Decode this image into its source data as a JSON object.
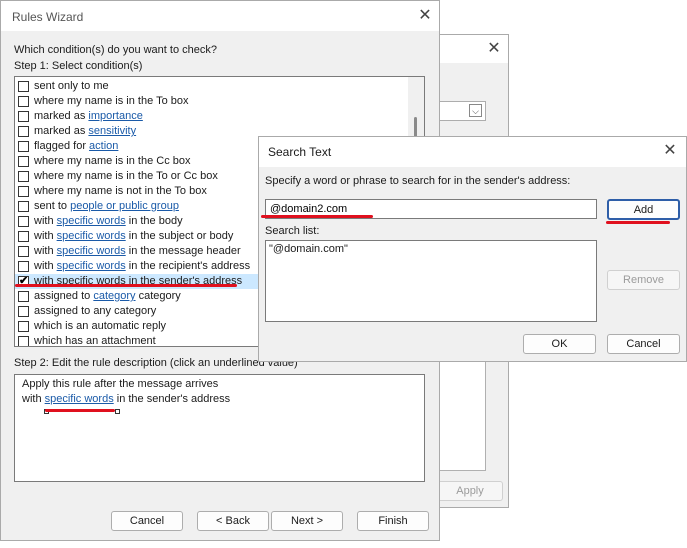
{
  "background_dialog": {
    "apply_label": "Apply"
  },
  "rules_wizard": {
    "title": "Rules Wizard",
    "question": "Which condition(s) do you want to check?",
    "step1": "Step 1: Select condition(s)",
    "conditions": [
      {
        "checked": false,
        "pre": "sent only to me",
        "link": "",
        "post": ""
      },
      {
        "checked": false,
        "pre": "where my name is in the To box",
        "link": "",
        "post": ""
      },
      {
        "checked": false,
        "pre": "marked as ",
        "link": "importance",
        "post": ""
      },
      {
        "checked": false,
        "pre": "marked as ",
        "link": "sensitivity",
        "post": ""
      },
      {
        "checked": false,
        "pre": "flagged for ",
        "link": "action",
        "post": ""
      },
      {
        "checked": false,
        "pre": "where my name is in the Cc box",
        "link": "",
        "post": ""
      },
      {
        "checked": false,
        "pre": "where my name is in the To or Cc box",
        "link": "",
        "post": ""
      },
      {
        "checked": false,
        "pre": "where my name is not in the To box",
        "link": "",
        "post": ""
      },
      {
        "checked": false,
        "pre": "sent to ",
        "link": "people or public group",
        "post": ""
      },
      {
        "checked": false,
        "pre": "with ",
        "link": "specific words",
        "post": " in the body"
      },
      {
        "checked": false,
        "pre": "with ",
        "link": "specific words",
        "post": " in the subject or body"
      },
      {
        "checked": false,
        "pre": "with ",
        "link": "specific words",
        "post": " in the message header"
      },
      {
        "checked": false,
        "pre": "with ",
        "link": "specific words",
        "post": " in the recipient's address"
      },
      {
        "checked": true,
        "pre": "with specific words in the sender's address",
        "link": "",
        "post": ""
      },
      {
        "checked": false,
        "pre": "assigned to ",
        "link": "category",
        "post": " category"
      },
      {
        "checked": false,
        "pre": "assigned to any category",
        "link": "",
        "post": ""
      },
      {
        "checked": false,
        "pre": "which is an automatic reply",
        "link": "",
        "post": ""
      },
      {
        "checked": false,
        "pre": "which has an attachment",
        "link": "",
        "post": ""
      }
    ],
    "step2": "Step 2: Edit the rule description (click an underlined value)",
    "desc_line1": "Apply this rule after the message arrives",
    "desc_line2_pre": "with ",
    "desc_line2_link": "specific words",
    "desc_line2_post": " in the sender's address",
    "buttons": {
      "cancel": "Cancel",
      "back": "< Back",
      "next": "Next >",
      "finish": "Finish"
    }
  },
  "search_text": {
    "title": "Search Text",
    "prompt": "Specify a word or phrase to search for in the sender's address:",
    "input_value": "@domain2.com",
    "add_label": "Add",
    "search_list_label": "Search list:",
    "search_list": [
      "\"@domain.com\""
    ],
    "remove_label": "Remove",
    "ok_label": "OK",
    "cancel_label": "Cancel"
  },
  "colors": {
    "annotation_red": "#e0101e",
    "link_blue": "#1a5aa8",
    "selection": "#cce8ff"
  }
}
